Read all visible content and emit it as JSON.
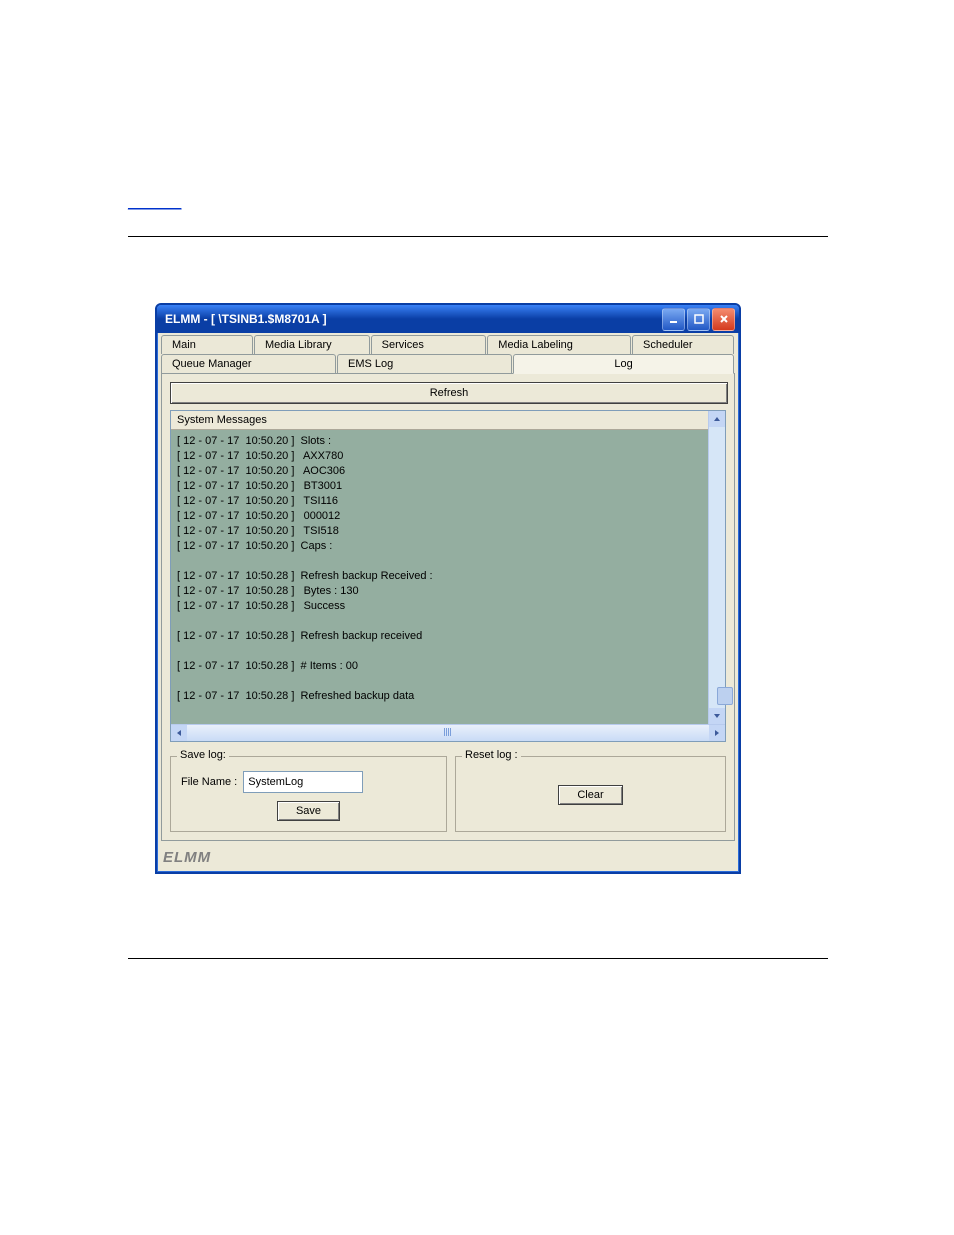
{
  "top_link": "________",
  "window": {
    "title": "ELMM - [ \\TSINB1.$M8701A ]"
  },
  "tabs_row1": [
    "Main",
    "Media Library",
    "Services",
    "Media Labeling",
    "Scheduler"
  ],
  "tabs_row2": [
    "Queue Manager",
    "EMS Log",
    "Log"
  ],
  "buttons": {
    "refresh": "Refresh",
    "save": "Save",
    "clear": "Clear"
  },
  "log_header": "System Messages",
  "log_lines": [
    "[ 12 - 07 - 17  10:50.20 ]  Slots :",
    "[ 12 - 07 - 17  10:50.20 ]   AXX780",
    "[ 12 - 07 - 17  10:50.20 ]   AOC306",
    "[ 12 - 07 - 17  10:50.20 ]   BT3001",
    "[ 12 - 07 - 17  10:50.20 ]   TSI116",
    "[ 12 - 07 - 17  10:50.20 ]   000012",
    "[ 12 - 07 - 17  10:50.20 ]   TSI518",
    "[ 12 - 07 - 17  10:50.20 ]  Caps :",
    "",
    "[ 12 - 07 - 17  10:50.28 ]  Refresh backup Received :",
    "[ 12 - 07 - 17  10:50.28 ]   Bytes : 130",
    "[ 12 - 07 - 17  10:50.28 ]   Success",
    "",
    "[ 12 - 07 - 17  10:50.28 ]  Refresh backup received",
    "",
    "[ 12 - 07 - 17  10:50.28 ]  # Items : 00",
    "",
    "[ 12 - 07 - 17  10:50.28 ]  Refreshed backup data"
  ],
  "groups": {
    "save_legend": "Save log:",
    "reset_legend": "Reset log :",
    "filename_label": "File Name :",
    "filename_value": "SystemLog"
  },
  "footer_brand": "ELMM"
}
